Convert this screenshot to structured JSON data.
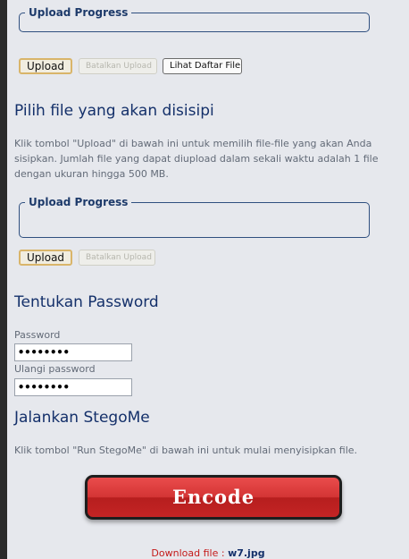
{
  "upload_box_1": {
    "legend": "Upload Progress"
  },
  "buttons_row_1": {
    "upload": "Upload",
    "cancel": "Batalkan Upload",
    "list": "Lihat Daftar File"
  },
  "section_pilih": {
    "title": "Pilih file yang akan disisipi",
    "lines": [
      "Klik tombol \"Upload\" di bawah ini untuk memilih file-file yang akan Anda",
      "sisipkan. Jumlah file yang dapat diupload dalam sekali waktu adalah 1 file",
      "dengan ukuran hingga 500 MB."
    ]
  },
  "upload_box_2": {
    "legend": "Upload Progress"
  },
  "buttons_row_2": {
    "upload": "Upload",
    "cancel": "Batalkan Upload"
  },
  "section_password": {
    "title": "Tentukan Password",
    "password_label": "Password",
    "password_value": "••••••••",
    "repeat_label": "Ulangi password",
    "repeat_value": "••••••••"
  },
  "section_run": {
    "title": "Jalankan StegoMe",
    "description": "Klik tombol \"Run StegoMe\" di bawah ini untuk mulai menyisipkan file.",
    "encode_label": "Encode",
    "download_prefix": "Download file : ",
    "download_filename": "w7.jpg"
  }
}
